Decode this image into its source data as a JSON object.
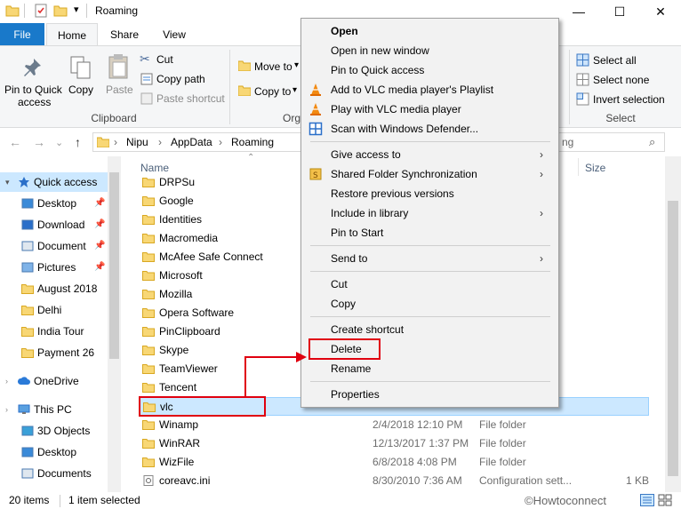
{
  "window": {
    "title": "Roaming",
    "minimize": "—",
    "maximize": "☐",
    "close": "✕"
  },
  "tabs": {
    "file": "File",
    "home": "Home",
    "share": "Share",
    "view": "View"
  },
  "ribbon": {
    "pin": "Pin to Quick",
    "pin2": "access",
    "copy": "Copy",
    "paste": "Paste",
    "cut": "Cut",
    "copy_path": "Copy path",
    "paste_shortcut": "Paste shortcut",
    "clipboard": "Clipboard",
    "move_to": "Move to",
    "copy_to": "Copy to",
    "organize_partial": "Org",
    "select_all": "Select all",
    "select_none": "Select none",
    "invert_selection": "Invert selection",
    "select": "Select"
  },
  "address": {
    "crumbs": [
      "Nipu",
      "AppData",
      "Roaming"
    ],
    "search_partial": "ng"
  },
  "columns": {
    "name": "Name",
    "size": "Size"
  },
  "nav": [
    {
      "label": "Quick access",
      "sel": true
    },
    {
      "label": "Desktop",
      "pin": true
    },
    {
      "label": "Download",
      "pin": true
    },
    {
      "label": "Document",
      "pin": true
    },
    {
      "label": "Pictures",
      "pin": true
    },
    {
      "label": "August 2018"
    },
    {
      "label": "Delhi"
    },
    {
      "label": "India Tour"
    },
    {
      "label": "Payment 26"
    },
    {
      "label": "OneDrive"
    },
    {
      "label": "This PC"
    },
    {
      "label": "3D Objects"
    },
    {
      "label": "Desktop"
    },
    {
      "label": "Documents"
    }
  ],
  "files": [
    {
      "name": "DRPSu",
      "date": "",
      "type": "",
      "size": ""
    },
    {
      "name": "Google",
      "date": "",
      "type": "",
      "size": ""
    },
    {
      "name": "Identities",
      "date": "",
      "type": "",
      "size": ""
    },
    {
      "name": "Macromedia",
      "date": "",
      "type": "",
      "size": ""
    },
    {
      "name": "McAfee Safe Connect",
      "date": "",
      "type": "",
      "size": ""
    },
    {
      "name": "Microsoft",
      "date": "",
      "type": "",
      "size": ""
    },
    {
      "name": "Mozilla",
      "date": "",
      "type": "",
      "size": ""
    },
    {
      "name": "Opera Software",
      "date": "",
      "type": "",
      "size": ""
    },
    {
      "name": "PinClipboard",
      "date": "",
      "type": "",
      "size": ""
    },
    {
      "name": "Skype",
      "date": "",
      "type": "",
      "size": ""
    },
    {
      "name": "TeamViewer",
      "date": "",
      "type": "",
      "size": ""
    },
    {
      "name": "Tencent",
      "date": "",
      "type": "",
      "size": ""
    },
    {
      "name": "vlc",
      "date": "",
      "type": "",
      "size": "",
      "sel": true
    },
    {
      "name": "Winamp",
      "date": "2/4/2018 12:10 PM",
      "type": "File folder",
      "size": ""
    },
    {
      "name": "WinRAR",
      "date": "12/13/2017 1:37 PM",
      "type": "File folder",
      "size": ""
    },
    {
      "name": "WizFile",
      "date": "6/8/2018 4:08 PM",
      "type": "File folder",
      "size": ""
    },
    {
      "name": "coreavc.ini",
      "date": "8/30/2010 7:36 AM",
      "type": "Configuration sett...",
      "size": "1 KB",
      "file": true
    }
  ],
  "status": {
    "items": "20 items",
    "selected": "1 item selected",
    "watermark": "©Howtoconnect"
  },
  "context_menu": [
    {
      "label": "Open",
      "bold": true
    },
    {
      "label": "Open in new window"
    },
    {
      "label": "Pin to Quick access"
    },
    {
      "label": "Add to VLC media player's Playlist",
      "icon": "vlc-icon"
    },
    {
      "label": "Play with VLC media player",
      "icon": "vlc-icon"
    },
    {
      "label": "Scan with Windows Defender...",
      "icon": "defender-icon"
    },
    {
      "sep": true
    },
    {
      "label": "Give access to",
      "arrow": true
    },
    {
      "label": "Shared Folder Synchronization",
      "arrow": true,
      "icon": "sync-icon"
    },
    {
      "label": "Restore previous versions"
    },
    {
      "label": "Include in library",
      "arrow": true
    },
    {
      "label": "Pin to Start"
    },
    {
      "sep": true
    },
    {
      "label": "Send to",
      "arrow": true
    },
    {
      "sep": true
    },
    {
      "label": "Cut"
    },
    {
      "label": "Copy"
    },
    {
      "sep": true
    },
    {
      "label": "Create shortcut"
    },
    {
      "label": "Delete",
      "highlight": true
    },
    {
      "label": "Rename"
    },
    {
      "sep": true
    },
    {
      "label": "Properties"
    }
  ]
}
